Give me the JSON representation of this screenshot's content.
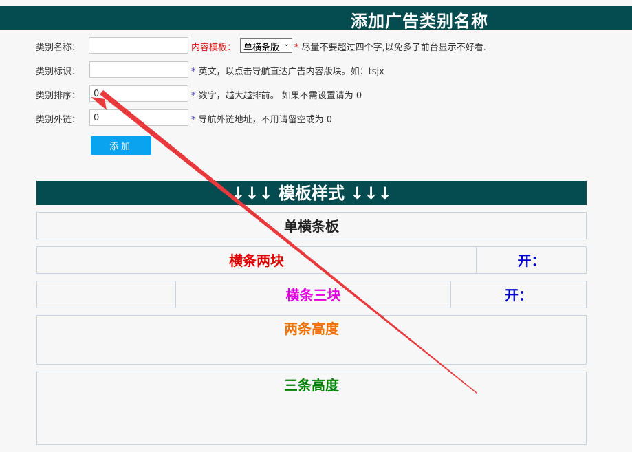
{
  "header": {
    "title": "添加广告类别名称"
  },
  "form": {
    "name": {
      "label": "类别名称：",
      "value": ""
    },
    "template": {
      "label": "内容模板：",
      "selected": "单横条版",
      "tip": " 尽量不要超过四个字,以免多了前台显示不好看."
    },
    "identifier": {
      "label": "类别标识：",
      "value": "",
      "tip": " 英文，以点击导航直达广告内容版块。如：tsjx"
    },
    "sort": {
      "label": "类别排序：",
      "value": "0",
      "tip": " 数字，越大越排前。 如果不需设置请为 0"
    },
    "link": {
      "label": "类别外链：",
      "value": "0",
      "tip": " 导航外链地址，不用请留空或为 0"
    },
    "star": "*",
    "submit_label": "添加"
  },
  "templates": {
    "heading": "↓↓↓ 模板样式 ↓↓↓",
    "single": {
      "label": "单横条板",
      "color": "#222222"
    },
    "two": {
      "label": "横条两块",
      "color": "#e00000",
      "side": "开：",
      "side_color": "#0000cc"
    },
    "three": {
      "label": "横条三块",
      "color": "#e000e0",
      "side": "开：",
      "side_color": "#0000cc"
    },
    "twoheight": {
      "label": "两条高度",
      "color": "#f07000"
    },
    "threeheight": {
      "label": "三条高度",
      "color": "#008000"
    }
  },
  "annotation": {
    "color": "#e8393c",
    "icon": "arrow-annotation"
  }
}
